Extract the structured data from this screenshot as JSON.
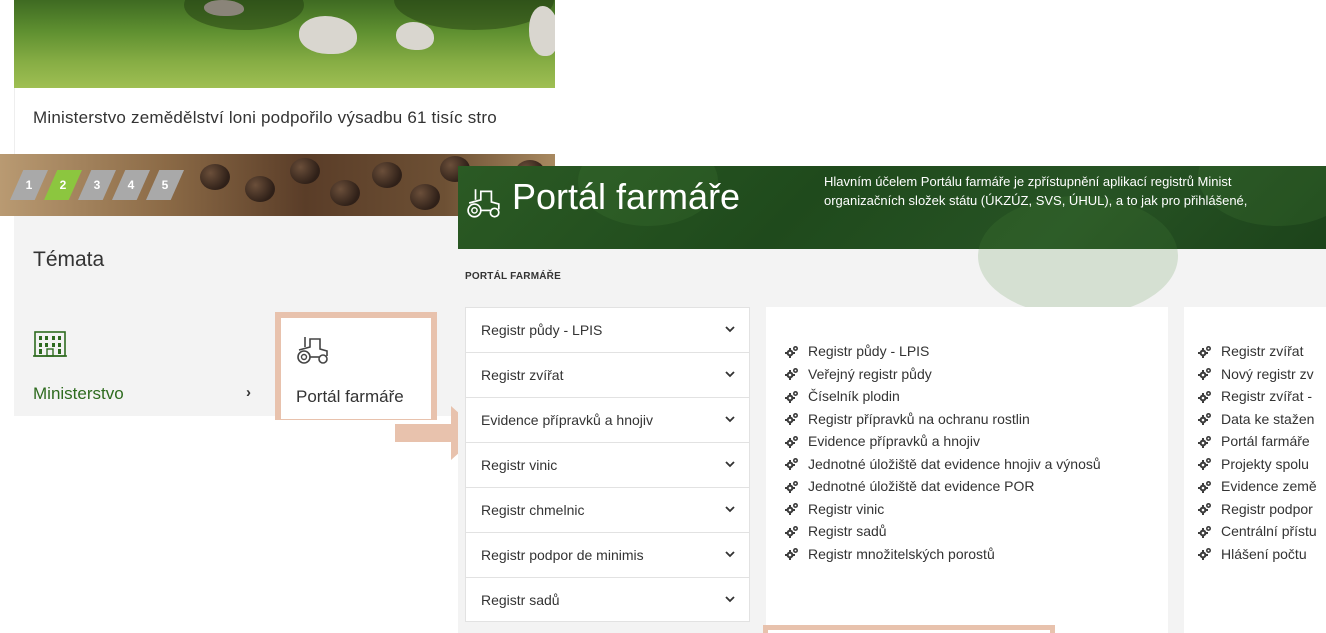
{
  "left": {
    "caption": "Ministerstvo zemědělství loni podpořilo výsadbu 61 tisíc stro",
    "pager": [
      "1",
      "2",
      "3",
      "4",
      "5"
    ],
    "pager_active": "2",
    "topics_title": "Témata",
    "ministry_icon": "building-icon",
    "ministry_label": "Ministerstvo",
    "ministry_chevron": "›",
    "portal_card_icon": "tractor-icon",
    "portal_card_label": "Portál farmáře"
  },
  "right": {
    "banner": {
      "icon": "tractor-icon",
      "title": "Portál farmáře",
      "description_line1": "Hlavním účelem Portálu farmáře je zpřístupnění aplikací registrů Minist",
      "description_line2": "organizačních složek státu (ÚKZÚZ, SVS, ÚHUL), a to jak pro přihlášené,"
    },
    "breadcrumb": "PORTÁL FARMÁŘE",
    "accordion": [
      "Registr půdy - LPIS",
      "Registr zvířat",
      "Evidence přípravků a hnojiv",
      "Registr vinic",
      "Registr chmelnic",
      "Registr podpor de minimis",
      "Registr sadů"
    ],
    "links_col1": [
      "Registr půdy - LPIS",
      "Veřejný registr půdy",
      "Číselník plodin",
      "Registr přípravků na ochranu rostlin",
      "Evidence přípravků a hnojiv",
      "Jednotné úložiště dat evidence hnojiv a výnosů",
      "Jednotné úložiště dat evidence POR",
      "Registr vinic",
      "Registr sadů",
      "Registr množitelských porostů"
    ],
    "links_col2": [
      "Registr zvířat",
      "Nový registr zv",
      "Registr zvířat -",
      "Data ke stažen",
      "Portál farmáře",
      "Projekty spolu",
      "Evidence země",
      "Registr podpor",
      "Centrální přístu",
      "Hlášení počtu"
    ],
    "link_icon": "app-gears-icon",
    "chevron_icon": "chevron-down-icon"
  },
  "colors": {
    "accent_green": "#2e6b1f",
    "pager_active": "#8cc63f",
    "highlight": "#e8c2ad",
    "banner": "#1f4a1c"
  }
}
